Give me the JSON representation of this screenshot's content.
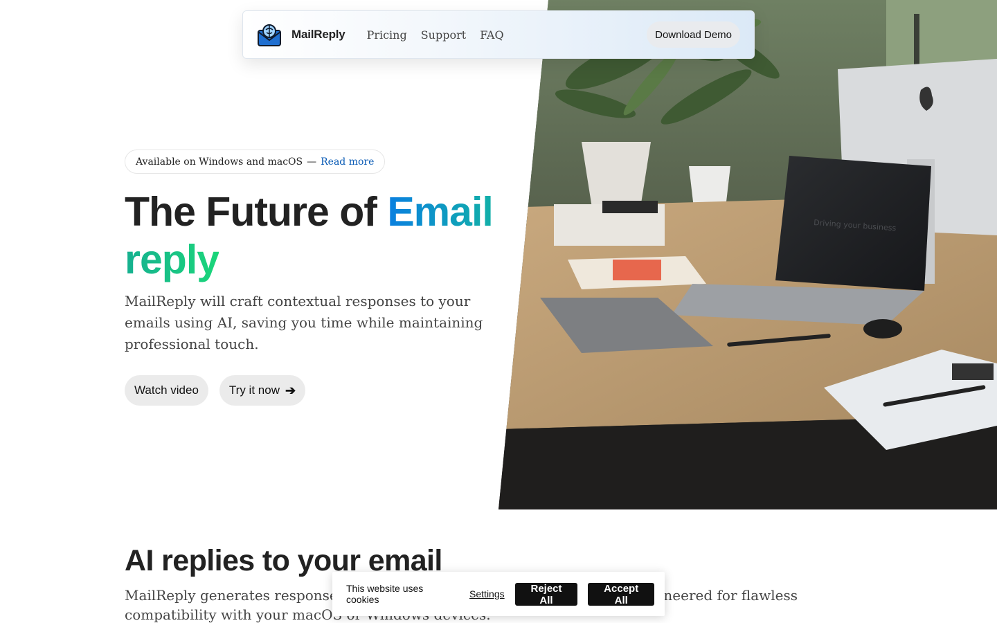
{
  "nav": {
    "brand": "MailReply",
    "links": [
      "Pricing",
      "Support",
      "FAQ"
    ],
    "cta": "Download Demo"
  },
  "hero": {
    "badge_text": "Available on Windows and macOS",
    "badge_separator": "—",
    "badge_link": "Read more",
    "title_part1": "The Future of",
    "title_highlight1": "Email",
    "title_highlight2": "reply",
    "subtitle": "MailReply will craft contextual responses to your emails using AI, saving you time while maintaining professional touch.",
    "watch_video": "Watch video",
    "try_now": "Try it now",
    "try_now_icon": "arrow-right-icon",
    "laptop_screen_text": "Driving your business"
  },
  "section": {
    "title": "AI replies to your email",
    "text": "MailReply generates responses to your emails using AI. Our software is engineered for flawless compatibility with your macOS or Windows devices."
  },
  "cookie": {
    "text": "This website uses cookies",
    "settings": "Settings",
    "reject": "Reject All",
    "accept": "Accept All"
  },
  "colors": {
    "email_gradient_start": "#0a7fe0",
    "email_gradient_end": "#12b0a8",
    "reply_gradient_start": "#16b090",
    "reply_gradient_end": "#1bd67a",
    "link": "#0a5bb5",
    "cookie_button": "#111111"
  }
}
